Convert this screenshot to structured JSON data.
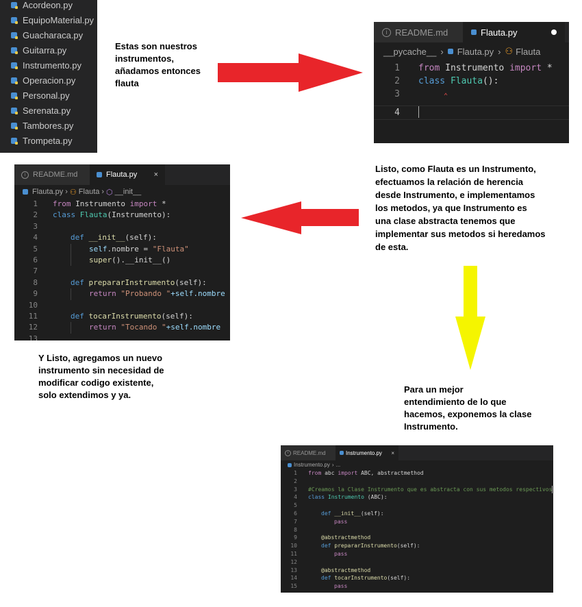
{
  "file_list": {
    "items": [
      "Acordeon.py",
      "EquipoMaterial.py",
      "Guacharaca.py",
      "Guitarra.py",
      "Instrumento.py",
      "Operacion.py",
      "Personal.py",
      "Serenata.py",
      "Tambores.py",
      "Trompeta.py"
    ]
  },
  "notes": {
    "n1": "Estas son nuestros\ninstrumentos,\nañadamos entonces\nflauta",
    "n2": "Listo, como Flauta es un Instrumento,\nefectuamos la relación de herencia\ndesde Instrumento, e implementamos\nlos metodos, ya que Instrumento es\nuna clase abstracta tenemos que\nimplementar sus metodos si heredamos\nde esta.",
    "n3": "Y Listo, agregamos un nuevo\ninstrumento sin necesidad de\nmodificar codigo existente,\nsolo extendimos y ya.",
    "n4": "Para un mejor\nentendimiento de lo que\nhacemos, exponemos la clase\nInstrumento."
  },
  "editor1": {
    "tab_readme": "README.md",
    "tab_active": "Flauta.py",
    "crumb_folder": "__pycache__",
    "crumb_file": "Flauta.py",
    "crumb_class": "Flauta",
    "lines": {
      "l1": {
        "n": "1",
        "kw1": "from",
        "mod": " Instrumento ",
        "kw2": "import",
        "rest": " *"
      },
      "l2": {
        "n": "2",
        "kw": "class",
        "name": " Flauta",
        "rest": "():"
      },
      "l3": {
        "n": "3"
      },
      "l4": {
        "n": "4"
      }
    }
  },
  "editor2": {
    "tab_readme": "README.md",
    "tab_active": "Flauta.py",
    "crumb_file": "Flauta.py",
    "crumb_class": "Flauta",
    "crumb_method": "__init__",
    "lines": {
      "l1": {
        "n": "1",
        "kw1": "from",
        "mod": " Instrumento ",
        "kw2": "import",
        "rest": " *"
      },
      "l2": {
        "n": "2",
        "kw": "class",
        "name": " Flauta",
        "rest": "(Instrumento):"
      },
      "l3": {
        "n": "3"
      },
      "l4": {
        "n": "4",
        "kw": "def",
        "name": " __init__",
        "rest": "(self):"
      },
      "l5": {
        "n": "5",
        "self": "self",
        "rest": ".nombre = ",
        "str": "\"Flauta\""
      },
      "l6": {
        "n": "6",
        "fn": "super",
        "rest": "().__init__()"
      },
      "l7": {
        "n": "7"
      },
      "l8": {
        "n": "8",
        "kw": "def",
        "name": " prepararInstrumento",
        "rest": "(self):"
      },
      "l9": {
        "n": "9",
        "kw": "return",
        "str": " \"Probando \"",
        "rest": "+self.nombre"
      },
      "l10": {
        "n": "10"
      },
      "l11": {
        "n": "11",
        "kw": "def",
        "name": " tocarInstrumento",
        "rest": "(self):"
      },
      "l12": {
        "n": "12",
        "kw": "return",
        "str": " \"Tocando \"",
        "rest": "+self.nombre"
      },
      "l13": {
        "n": "13"
      }
    }
  },
  "editor3": {
    "tab_readme": "README.md",
    "tab_active": "Instrumento.py",
    "crumb_file": "Instrumento.py",
    "crumb_more": "...",
    "lines": {
      "l1": {
        "n": "1",
        "kw1": "from",
        "mod": " abc ",
        "kw2": "import",
        "rest": " ABC, abstractmethod"
      },
      "l2": {
        "n": "2"
      },
      "l3": {
        "n": "3",
        "cm": "#Creamos la Clase Instrumento que es abstracta con sus metodos respectivos"
      },
      "l4": {
        "n": "4",
        "kw": "class",
        "name": " Instrumento",
        "rest": " (ABC):"
      },
      "l5": {
        "n": "5"
      },
      "l6": {
        "n": "6",
        "kw": "def",
        "name": " __init__",
        "rest": "(self):"
      },
      "l7": {
        "n": "7",
        "kw": "pass"
      },
      "l8": {
        "n": "8"
      },
      "l9": {
        "n": "9",
        "deco": "@abstractmethod"
      },
      "l10": {
        "n": "10",
        "kw": "def",
        "name": " prepararInstrumento",
        "rest": "(self):"
      },
      "l11": {
        "n": "11",
        "kw": "pass"
      },
      "l12": {
        "n": "12"
      },
      "l13": {
        "n": "13",
        "deco": "@abstractmethod"
      },
      "l14": {
        "n": "14",
        "kw": "def",
        "name": " tocarInstrumento",
        "rest": "(self):"
      },
      "l15": {
        "n": "15",
        "kw": "pass"
      }
    }
  },
  "colors": {
    "arrow_red": "#e8252a",
    "arrow_yellow": "#f5f500",
    "editor_bg": "#1e1e1e"
  },
  "icons": [
    "python-file-icon",
    "info-icon",
    "close-icon",
    "chevron-right-icon",
    "class-icon",
    "method-icon",
    "arrow-right",
    "arrow-left",
    "arrow-down"
  ]
}
